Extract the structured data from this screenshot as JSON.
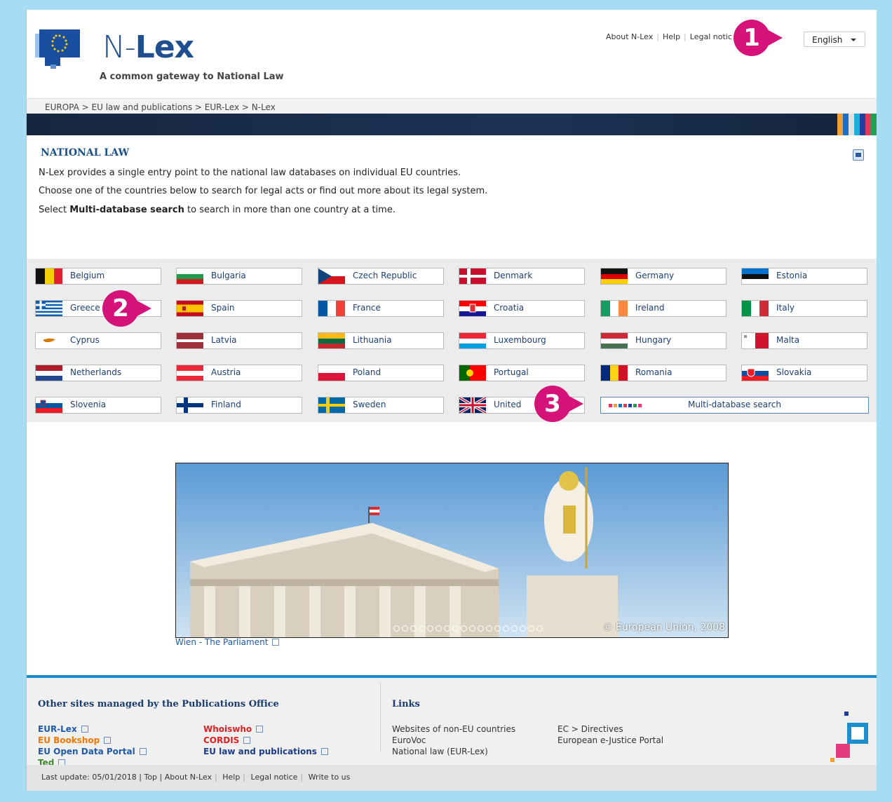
{
  "header": {
    "logo_prefix": "N-",
    "logo_bold": "Lex",
    "subtitle": "A common gateway to National Law",
    "links": [
      "About N-Lex",
      "Help",
      "Legal notic"
    ],
    "language": "English"
  },
  "breadcrumb": "EUROPA > EU law and publications > EUR-Lex > N-Lex",
  "colors": {
    "strip": [
      "#f0a030",
      "#1a6fc2",
      "#e0e0e0",
      "#1ab0d8",
      "#2040a0",
      "#e23a5a",
      "#20a050"
    ],
    "accent": "#1588c7",
    "callout": "#d4127a"
  },
  "content": {
    "title": "NATIONAL LAW",
    "intro1": "N-Lex provides a single entry point to the national law databases on individual EU countries.",
    "intro2": "Choose one of the countries below to search for legal acts or find out more about its legal system.",
    "intro3_bold": "Multi-database search",
    "intro3_pre": "Select ",
    "intro3_post": " to search in more than one country at a time."
  },
  "countries": [
    "Belgium",
    "Bulgaria",
    "Czech Republic",
    "Denmark",
    "Germany",
    "Estonia",
    "Greece",
    "Spain",
    "France",
    "Croatia",
    "Ireland",
    "Italy",
    "Cyprus",
    "Latvia",
    "Lithuania",
    "Luxembourg",
    "Hungary",
    "Malta",
    "Netherlands",
    "Austria",
    "Poland",
    "Portugal",
    "Romania",
    "Slovakia",
    "Slovenia",
    "Finland",
    "Sweden",
    "United"
  ],
  "multi_search": "Multi-database search",
  "slideshow": {
    "caption": "Wien - The Parliament",
    "copyright": "© European Union, 2008",
    "dot_count": 18
  },
  "footer": {
    "title_left": "Other sites managed by the Publications Office",
    "title_right": "Links",
    "col1": [
      "EUR-Lex",
      "EU Bookshop",
      "EU Open Data Portal",
      "Ted"
    ],
    "col2": [
      "Whoiswho",
      "CORDIS",
      "EU law and publications"
    ],
    "col3": [
      "Websites of non-EU countries",
      "EuroVoc",
      "National law (EUR-Lex)"
    ],
    "col4": [
      "EC > Directives",
      "European e-Justice Portal"
    ],
    "bar": [
      "Last update: 05/01/2018 | Top |",
      "About N-Lex",
      "Help",
      "Legal notice",
      "Write to us"
    ]
  },
  "callouts": [
    "1",
    "2",
    "3"
  ]
}
